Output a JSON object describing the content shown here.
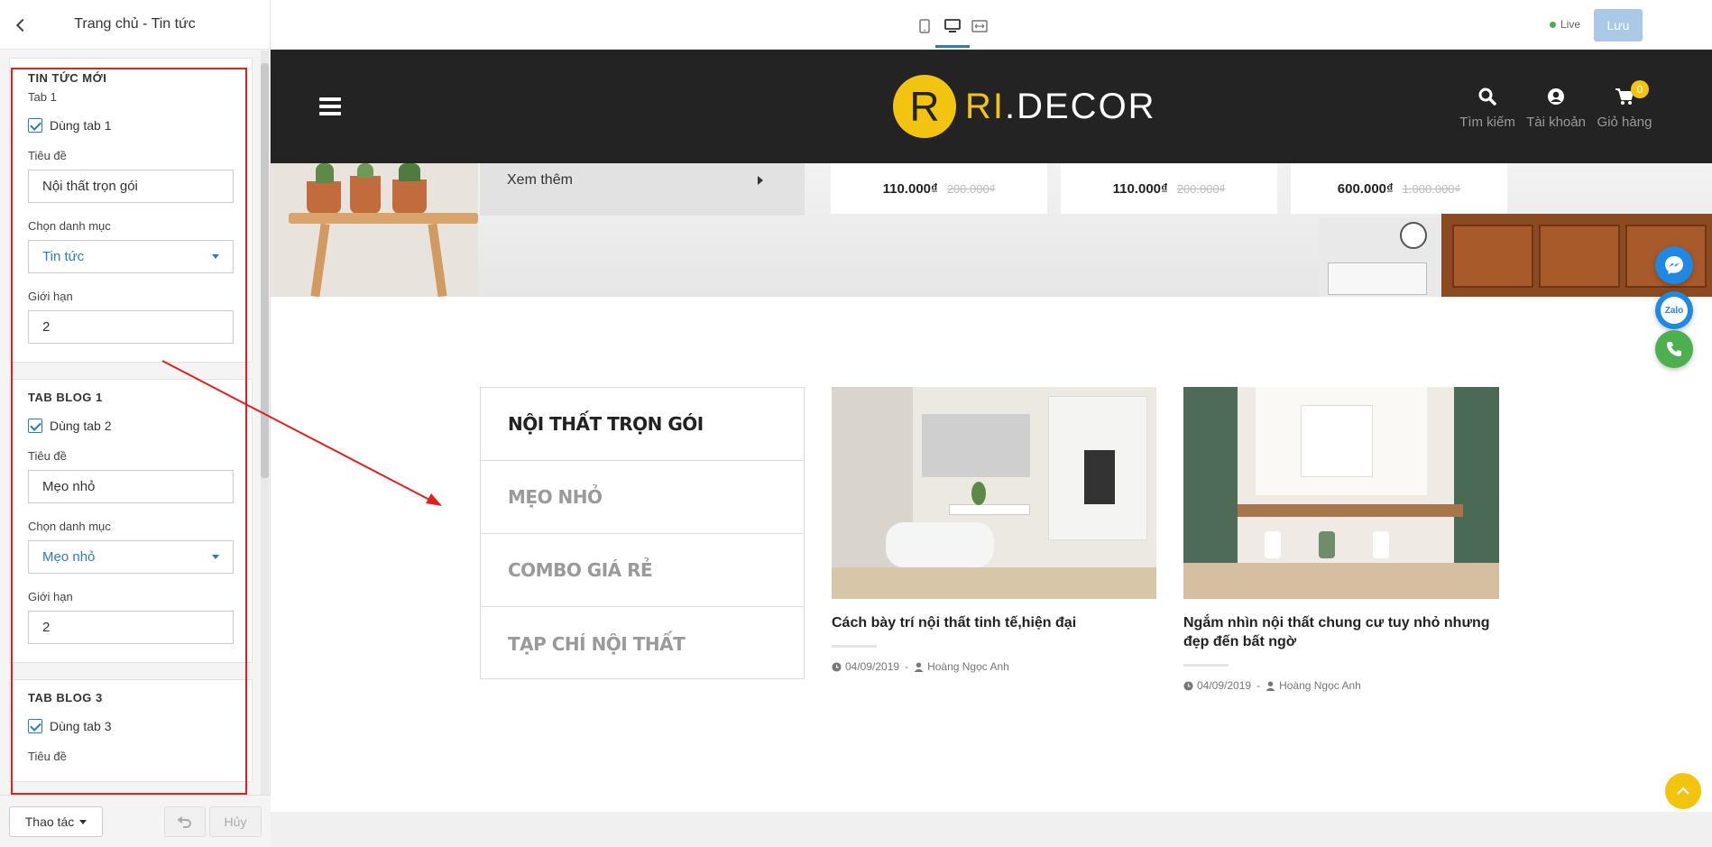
{
  "panel": {
    "title": "Trang chủ - Tin tức",
    "sections": [
      {
        "title": "TIN TỨC MỚI",
        "sub": "Tab 1",
        "checkbox_label": "Dùng tab 1",
        "title_label": "Tiêu đề",
        "title_value": "Nội thất trọn gói",
        "category_label": "Chọn danh mục",
        "category_value": "Tin tức",
        "limit_label": "Giới hạn",
        "limit_value": "2"
      },
      {
        "title": "TAB BLOG 1",
        "checkbox_label": "Dùng tab 2",
        "title_label": "Tiêu đề",
        "title_value": "Mẹo nhỏ",
        "category_label": "Chọn danh mục",
        "category_value": "Mẹo nhỏ",
        "limit_label": "Giới hạn",
        "limit_value": "2"
      },
      {
        "title": "TAB BLOG 3",
        "checkbox_label": "Dùng tab 3",
        "title_label": "Tiêu đề"
      }
    ],
    "footer": {
      "actions_label": "Thao tác",
      "cancel_label": "Hủy"
    }
  },
  "topbar": {
    "live_label": "Live",
    "save_label": "Lưu"
  },
  "site": {
    "logo": {
      "letter": "R",
      "brand_a": "RI",
      "brand_b": ".DECOR"
    },
    "header_icons": [
      {
        "label": "Tìm kiếm",
        "icon": "search-icon"
      },
      {
        "label": "Tài khoản",
        "icon": "user-icon"
      },
      {
        "label": "Giỏ hàng",
        "icon": "cart-icon",
        "badge": "0"
      }
    ],
    "xem_them": "Xem thêm",
    "prices": [
      {
        "now": "110.000₫",
        "old": "200.000₫"
      },
      {
        "now": "110.000₫",
        "old": "200.000₫"
      },
      {
        "now": "600.000₫",
        "old": "1.000.000₫"
      }
    ],
    "tabs": [
      "NỘI THẤT TRỌN GÓI",
      "MẸO NHỎ",
      "COMBO GIÁ RẺ",
      "TẠP CHÍ NỘI THẤT"
    ],
    "posts": [
      {
        "title": "Cách bày trí nội thất tinh tế,hiện đại",
        "date": "04/09/2019",
        "author": "Hoàng Ngọc Anh"
      },
      {
        "title": "Ngắm nhìn nội thất chung cư tuy nhỏ nhưng đẹp đến bất ngờ",
        "date": "04/09/2019",
        "author": "Hoàng Ngọc Anh"
      }
    ],
    "float_zalo": "Zalo"
  },
  "colors": {
    "accent": "#2b7bc0",
    "brand_yellow": "#f2c30f",
    "header_dark": "#232323",
    "annotation_red": "#e02020"
  }
}
